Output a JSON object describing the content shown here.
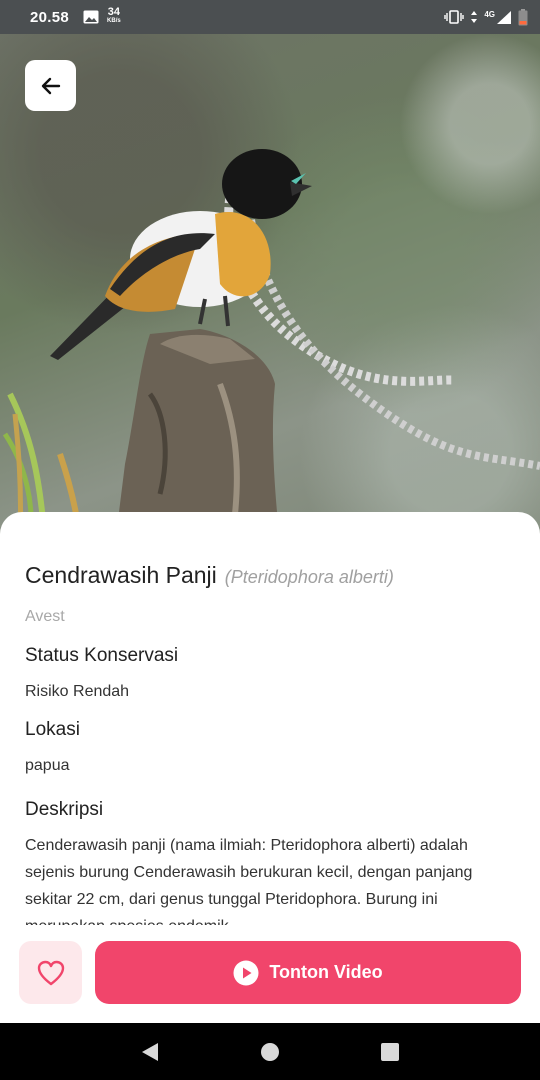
{
  "status_bar": {
    "time": "20.58",
    "speed_value": "34",
    "speed_unit": "KB/s",
    "network": "4G"
  },
  "header": {
    "back_icon": "arrow-left-icon"
  },
  "species": {
    "name": "Cendrawasih Panji",
    "latin_name": "(Pteridophora alberti)",
    "class": "Avest"
  },
  "sections": {
    "conservation_heading": "Status Konservasi",
    "conservation_value": "Risiko Rendah",
    "location_heading": "Lokasi",
    "location_value": "papua",
    "description_heading": "Deskripsi",
    "description_text": "Cenderawasih panji (nama ilmiah: Pteridophora alberti) adalah sejenis burung Cenderawasih berukuran kecil, dengan panjang sekitar 22 cm, dari genus tunggal Pteridophora. Burung ini merupakan spesies endemik"
  },
  "actions": {
    "favorite_icon": "heart-icon",
    "video_label": "Tonton Video",
    "video_icon": "play-circle-icon"
  },
  "colors": {
    "accent": "#f1456b",
    "favorite_bg": "#fde8eb"
  }
}
